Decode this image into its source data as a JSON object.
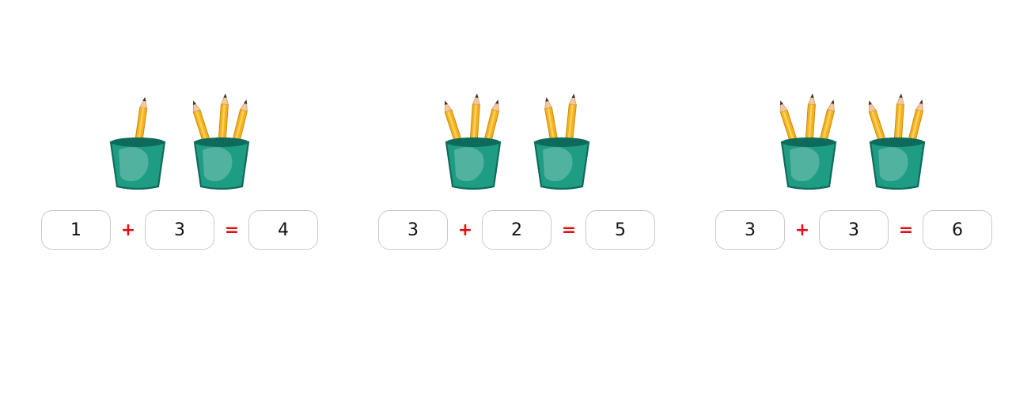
{
  "colors": {
    "cup_body": "#1f9d84",
    "cup_rim": "#0e6b5b",
    "pencil": "#f5b21d",
    "operator": "#e01010"
  },
  "icons": {
    "cup": "pencil-cup-icon",
    "pencil": "pencil-icon"
  },
  "problems": [
    {
      "left_cup_pencils": 1,
      "right_cup_pencils": 3,
      "a": "1",
      "op": "+",
      "b": "3",
      "eq": "=",
      "result": "4"
    },
    {
      "left_cup_pencils": 3,
      "right_cup_pencils": 2,
      "a": "3",
      "op": "+",
      "b": "2",
      "eq": "=",
      "result": "5"
    },
    {
      "left_cup_pencils": 3,
      "right_cup_pencils": 3,
      "a": "3",
      "op": "+",
      "b": "3",
      "eq": "=",
      "result": "6"
    }
  ]
}
